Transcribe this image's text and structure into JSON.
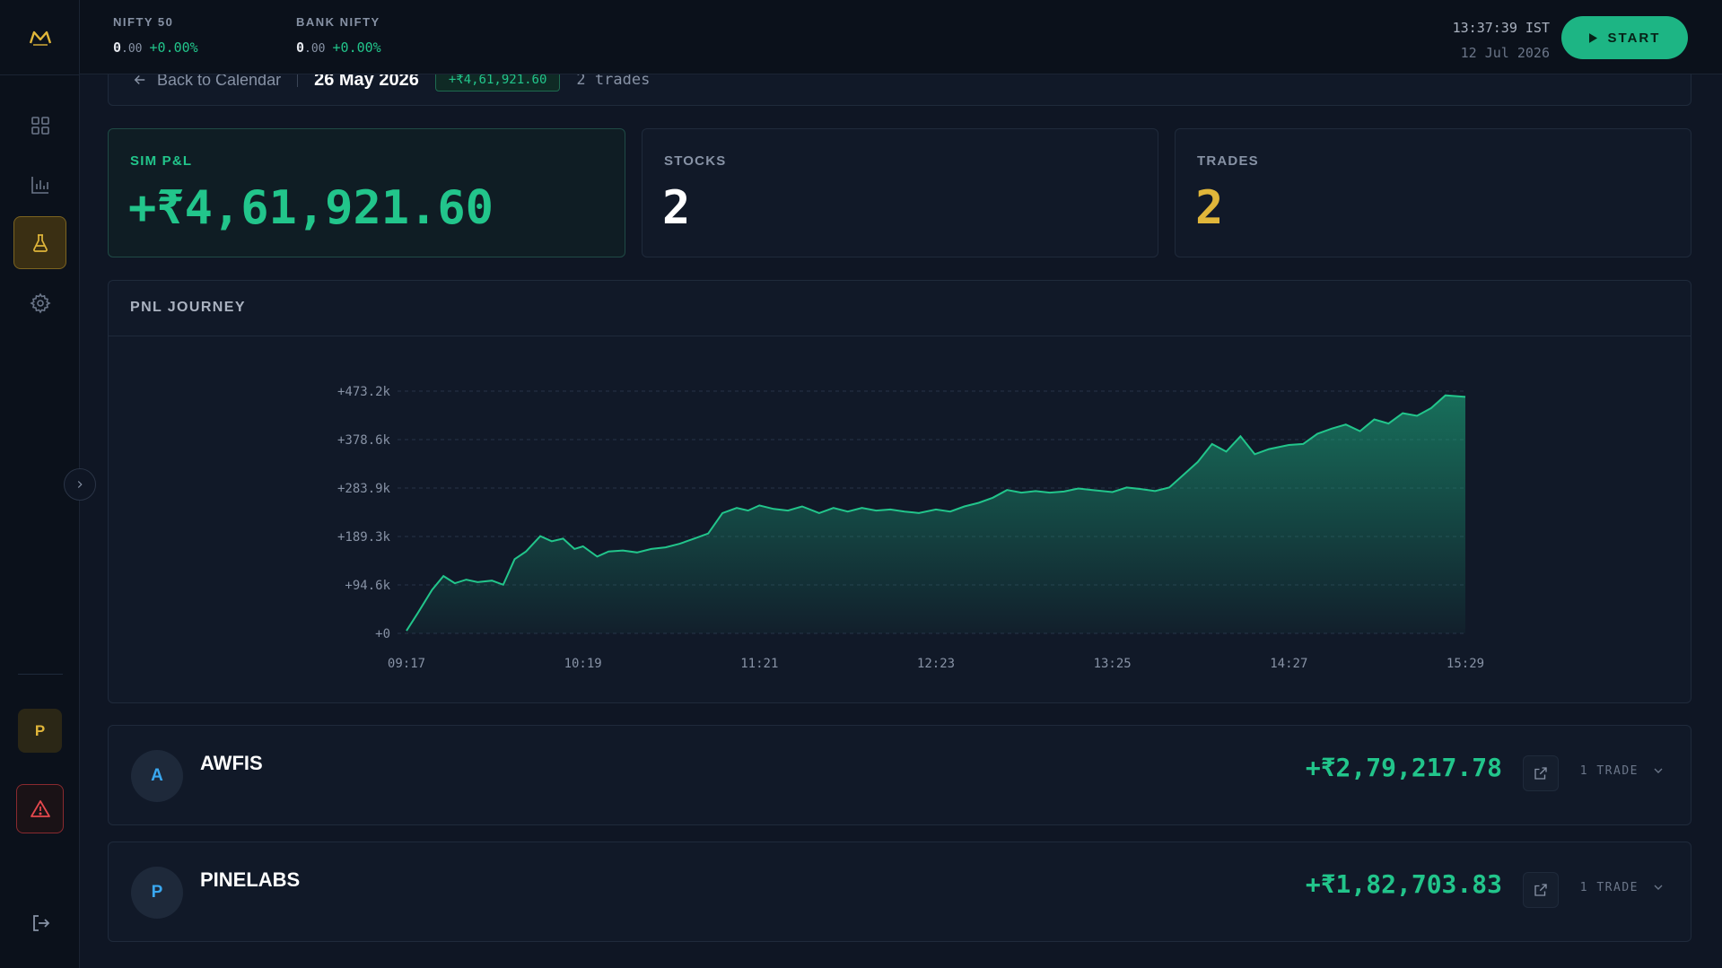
{
  "header": {
    "tickers": [
      {
        "name": "NIFTY 50",
        "price_int": "0",
        "price_dec": ".00",
        "change": "+0.00%"
      },
      {
        "name": "BANK NIFTY",
        "price_int": "0",
        "price_dec": ".00",
        "change": "+0.00%"
      }
    ],
    "clock_time": "13:37:39 IST",
    "clock_date": "12 Jul 2026",
    "start_label": "START"
  },
  "breadcrumb": {
    "back_label": "Back to Calendar",
    "date": "26 May 2026",
    "pnl_badge": "+₹4,61,921.60",
    "trades": "2 trades"
  },
  "stats": {
    "pnl_label": "SIM P&L",
    "pnl_value": "+₹4,61,921.60",
    "stocks_label": "STOCKS",
    "stocks_value": "2",
    "trades_label": "TRADES",
    "trades_value": "2"
  },
  "sidebar": {
    "profile_initial": "P"
  },
  "colors": {
    "accent_green": "#22c58b",
    "accent_gold": "#e0b63a",
    "danger": "#e5484d"
  },
  "chart_title": "PNL JOURNEY",
  "chart_data": {
    "type": "area",
    "title": "PNL JOURNEY",
    "xlabel": "",
    "ylabel": "",
    "x_ticks": [
      "09:17",
      "10:19",
      "11:21",
      "12:23",
      "13:25",
      "14:27",
      "15:29"
    ],
    "y_ticks": [
      "+0",
      "+94.6k",
      "+189.3k",
      "+283.9k",
      "+378.6k",
      "+473.2k"
    ],
    "ylim": [
      0,
      473200
    ],
    "grid": true,
    "series": [
      {
        "x": [
          "09:17",
          "09:21",
          "09:26",
          "09:30",
          "09:34",
          "09:38",
          "09:42",
          "09:47",
          "09:51",
          "09:55",
          "09:59",
          "10:04",
          "10:08",
          "10:12",
          "10:16",
          "10:19",
          "10:24",
          "10:28",
          "10:33",
          "10:38",
          "10:43",
          "10:48",
          "10:53",
          "10:58",
          "11:03",
          "11:08",
          "11:13",
          "11:17",
          "11:21",
          "11:26",
          "11:31",
          "11:36",
          "11:42",
          "11:47",
          "11:52",
          "11:57",
          "12:02",
          "12:07",
          "12:12",
          "12:17",
          "12:23",
          "12:28",
          "12:33",
          "12:38",
          "12:43",
          "12:48",
          "12:53",
          "12:58",
          "13:03",
          "13:08",
          "13:13",
          "13:18",
          "13:25",
          "13:30",
          "13:35",
          "13:40",
          "13:45",
          "13:50",
          "13:55",
          "14:00",
          "14:05",
          "14:10",
          "14:15",
          "14:20",
          "14:27",
          "14:32",
          "14:37",
          "14:42",
          "14:47",
          "14:52",
          "14:57",
          "15:02",
          "15:07",
          "15:12",
          "15:17",
          "15:22",
          "15:29"
        ],
        "values": [
          5000,
          40000,
          85000,
          112000,
          98000,
          105000,
          100000,
          103000,
          95000,
          145000,
          160000,
          190000,
          180000,
          185000,
          165000,
          170000,
          150000,
          160000,
          162000,
          158000,
          165000,
          168000,
          175000,
          185000,
          195000,
          235000,
          245000,
          240000,
          250000,
          243000,
          240000,
          248000,
          235000,
          245000,
          238000,
          245000,
          240000,
          242000,
          238000,
          235000,
          242000,
          238000,
          248000,
          255000,
          265000,
          280000,
          275000,
          278000,
          275000,
          277000,
          283000,
          280000,
          276000,
          285000,
          282000,
          278000,
          285000,
          310000,
          335000,
          370000,
          355000,
          385000,
          350000,
          360000,
          368000,
          370000,
          390000,
          400000,
          408000,
          395000,
          418000,
          410000,
          430000,
          425000,
          440000,
          465000,
          462000
        ]
      }
    ]
  },
  "stocks": [
    {
      "initial": "A",
      "name": "AWFIS",
      "pnl": "+₹2,79,217.78",
      "trades": "1 TRADE"
    },
    {
      "initial": "P",
      "name": "PINELABS",
      "pnl": "+₹1,82,703.83",
      "trades": "1 TRADE"
    }
  ]
}
